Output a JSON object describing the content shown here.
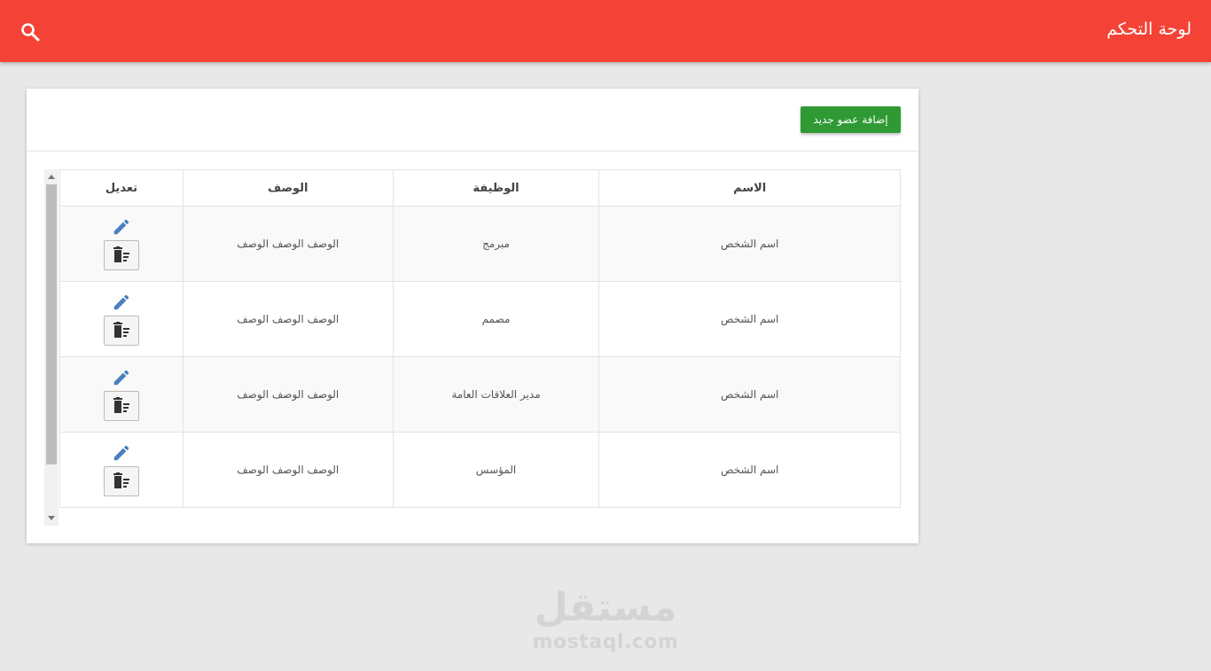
{
  "header": {
    "title": "لوحة التحكم",
    "color": "#f44336"
  },
  "card": {
    "add_button_label": "إضافة عضو جديد",
    "add_button_color": "#2f9a34"
  },
  "table": {
    "headers": {
      "name": "الاسم",
      "job": "الوظيفة",
      "desc": "الوصف",
      "edit": "تعديل"
    },
    "rows": [
      {
        "name": "اسم الشخص",
        "job": "مبرمج",
        "desc": "الوصف الوصف الوصف"
      },
      {
        "name": "اسم الشخص",
        "job": "مصمم",
        "desc": "الوصف الوصف الوصف"
      },
      {
        "name": "اسم الشخص",
        "job": "مدير العلاقات العامة",
        "desc": "الوصف الوصف الوصف"
      },
      {
        "name": "اسم الشخص",
        "job": "المؤسس",
        "desc": "الوصف الوصف الوصف"
      }
    ]
  },
  "icons": {
    "search": "search-icon",
    "edit": "pencil-icon",
    "delete": "trash-icon"
  },
  "watermark": {
    "arabic": "مستقل",
    "latin": "mostaql.com"
  }
}
